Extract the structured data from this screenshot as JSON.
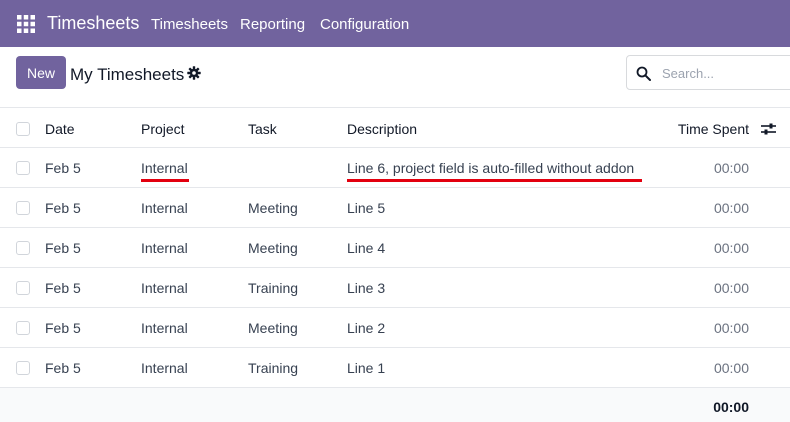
{
  "navbar": {
    "app_title": "Timesheets",
    "menus": [
      "Timesheets",
      "Reporting",
      "Configuration"
    ],
    "background": "#71639e"
  },
  "control_panel": {
    "new_label": "New",
    "view_title": "My Timesheets",
    "search_placeholder": "Search..."
  },
  "table": {
    "columns": {
      "date": "Date",
      "project": "Project",
      "task": "Task",
      "description": "Description",
      "time_spent": "Time Spent"
    },
    "rows": [
      {
        "date": "Feb 5",
        "project": "Internal",
        "task": "",
        "description": "Line 6, project field is auto-filled without addon",
        "time": "00:00"
      },
      {
        "date": "Feb 5",
        "project": "Internal",
        "task": "Meeting",
        "description": "Line 5",
        "time": "00:00"
      },
      {
        "date": "Feb 5",
        "project": "Internal",
        "task": "Meeting",
        "description": "Line 4",
        "time": "00:00"
      },
      {
        "date": "Feb 5",
        "project": "Internal",
        "task": "Training",
        "description": "Line 3",
        "time": "00:00"
      },
      {
        "date": "Feb 5",
        "project": "Internal",
        "task": "Meeting",
        "description": "Line 2",
        "time": "00:00"
      },
      {
        "date": "Feb 5",
        "project": "Internal",
        "task": "Training",
        "description": "Line 1",
        "time": "00:00"
      }
    ],
    "total": "00:00"
  },
  "annotation_color": "#e3000f"
}
